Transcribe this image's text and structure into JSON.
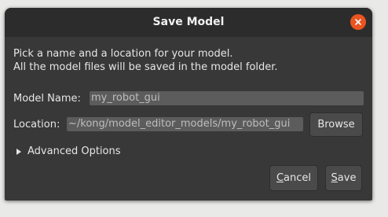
{
  "dialog": {
    "title": "Save Model",
    "close_icon": "close-icon",
    "accent_color": "#e95420"
  },
  "description": {
    "line1": "Pick a name and a location for your model.",
    "line2": "All the model files will be saved in the model folder."
  },
  "form": {
    "model_name_label": "Model Name:",
    "model_name_value": "my_robot_gui",
    "location_label": "Location:",
    "location_value": "~/kong/model_editor_models/my_robot_gui",
    "browse_label": "Browse"
  },
  "advanced": {
    "label": "Advanced Options",
    "icon": "triangle-right-icon"
  },
  "actions": {
    "cancel_mnemonic": "C",
    "cancel_rest": "ancel",
    "save_mnemonic": "S",
    "save_rest": "ave"
  }
}
